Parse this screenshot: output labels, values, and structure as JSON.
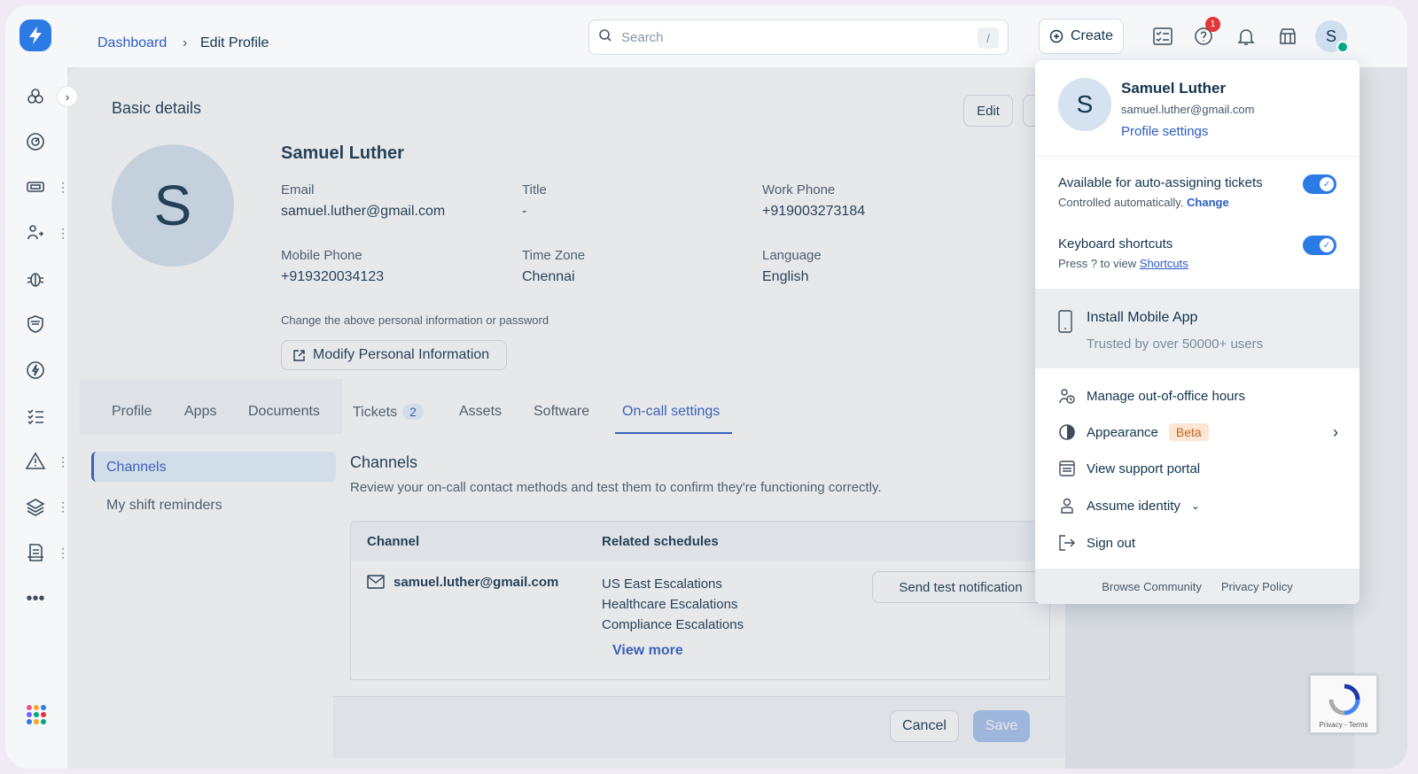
{
  "header": {
    "breadcrumb": {
      "root": "Dashboard",
      "separator": "›",
      "current": "Edit Profile"
    },
    "search": {
      "placeholder": "Search",
      "shortcut": "/"
    },
    "create_label": "Create",
    "notification_count": "1",
    "user_initial": "S"
  },
  "profile": {
    "section_title": "Basic details",
    "edit_label": "Edit",
    "initial": "S",
    "name": "Samuel Luther",
    "fields": [
      {
        "label": "Email",
        "value": "samuel.luther@gmail.com"
      },
      {
        "label": "Title",
        "value": "-"
      },
      {
        "label": "Work Phone",
        "value": "+919003273184"
      },
      {
        "label": "Mobile Phone",
        "value": "+919320034123"
      },
      {
        "label": "Time Zone",
        "value": "Chennai"
      },
      {
        "label": "Language",
        "value": "English"
      }
    ],
    "hint": "Change the above personal information or password",
    "modify_label": "Modify Personal Information"
  },
  "tabs": [
    {
      "label": "Profile"
    },
    {
      "label": "Apps"
    },
    {
      "label": "Documents"
    },
    {
      "label": "Tickets",
      "count": "2"
    },
    {
      "label": "Assets"
    },
    {
      "label": "Software"
    },
    {
      "label": "On-call settings",
      "active": true
    }
  ],
  "oncall": {
    "sidebar": [
      "Channels",
      "My shift reminders"
    ],
    "title": "Channels",
    "description": "Review your on-call contact methods and test them to confirm they're functioning correctly.",
    "columns": [
      "Channel",
      "Related schedules"
    ],
    "rows": [
      {
        "channel": "samuel.luther@gmail.com",
        "schedules": [
          "US East Escalations",
          "Healthcare Escalations",
          "Compliance Escalations"
        ],
        "view_more": "View more",
        "action": "Send test notification"
      }
    ]
  },
  "footer": {
    "cancel": "Cancel",
    "save": "Save"
  },
  "user_menu": {
    "initial": "S",
    "name": "Samuel Luther",
    "email": "samuel.luther@gmail.com",
    "profile_settings": "Profile settings",
    "auto_assign": {
      "label": "Available for auto-assigning tickets",
      "sub": "Controlled automatically.",
      "link": "Change",
      "enabled": true
    },
    "shortcuts": {
      "label": "Keyboard shortcuts",
      "sub": "Press ? to view",
      "link": "Shortcuts",
      "enabled": true
    },
    "install": {
      "label": "Install Mobile App",
      "sub": "Trusted by over 50000+ users"
    },
    "items": [
      {
        "label": "Manage out-of-office hours",
        "icon": "out-of-office-icon"
      },
      {
        "label": "Appearance",
        "badge": "Beta",
        "icon": "appearance-icon"
      },
      {
        "label": "View support portal",
        "icon": "portal-icon"
      },
      {
        "label": "Assume identity",
        "icon": "person-icon"
      },
      {
        "label": "Sign out",
        "icon": "sign-out-icon"
      }
    ],
    "footer": [
      "Browse Community",
      "Privacy Policy"
    ]
  },
  "recaptcha": {
    "text": "Privacy - Terms"
  },
  "colors": {
    "accent": "#2c5cc5",
    "toggle": "#2c7be5",
    "presence": "#00a886",
    "badge": "#e43538"
  }
}
